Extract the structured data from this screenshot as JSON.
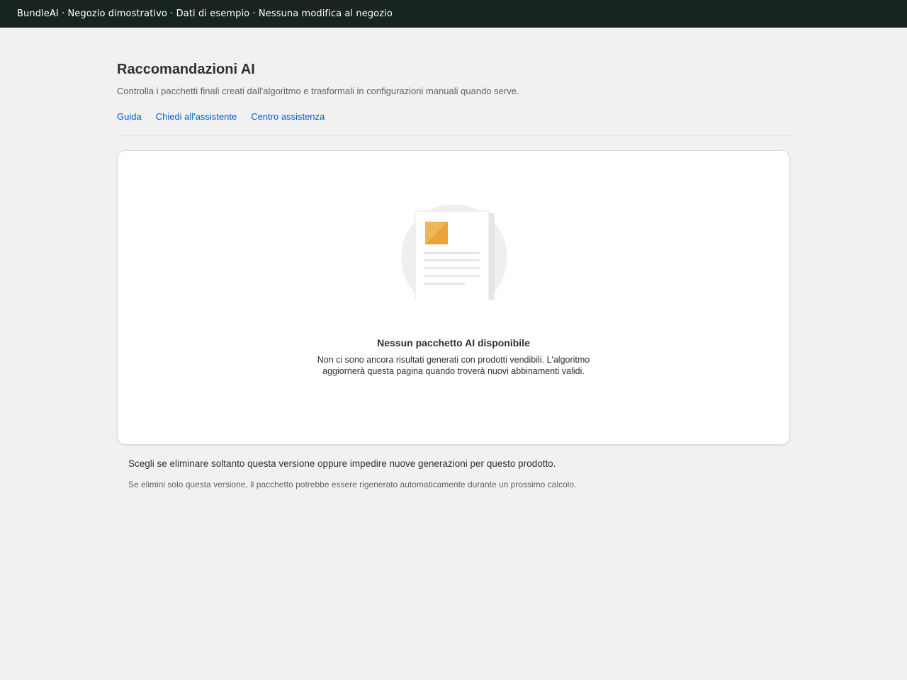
{
  "topbar": {
    "text": "BundleAI · Negozio dimostrativo · Dati di esempio · Nessuna modifica al negozio"
  },
  "header": {
    "title": "Raccomandazioni AI",
    "subtitle": "Controlla i pacchetti finali creati dall'algoritmo e trasformali in configurazioni manuali quando serve."
  },
  "help_links": [
    {
      "label": "Guida"
    },
    {
      "label": "Chiedi all'assistente"
    },
    {
      "label": "Centro assistenza"
    }
  ],
  "empty_state": {
    "icon": "empty-document-illustration",
    "title": "Nessun pacchetto AI disponibile",
    "description": "Non ci sono ancora risultati generati con prodotti vendibili. L'algoritmo aggiornerà questa pagina quando troverà nuovi abbinamenti validi."
  },
  "footer": {
    "note": "Scegli se eliminare soltanto questa versione oppure impedire nuove generazioni per questo prodotto.",
    "help": "Se elimini solo questa versione, il pacchetto potrebbe essere rigenerato automaticamente durante un prossimo calcolo."
  },
  "colors": {
    "topbar_bg": "#18251f",
    "link": "#005bd3",
    "page_bg": "#f1f1f1",
    "accent_square": "#e8a33c"
  }
}
